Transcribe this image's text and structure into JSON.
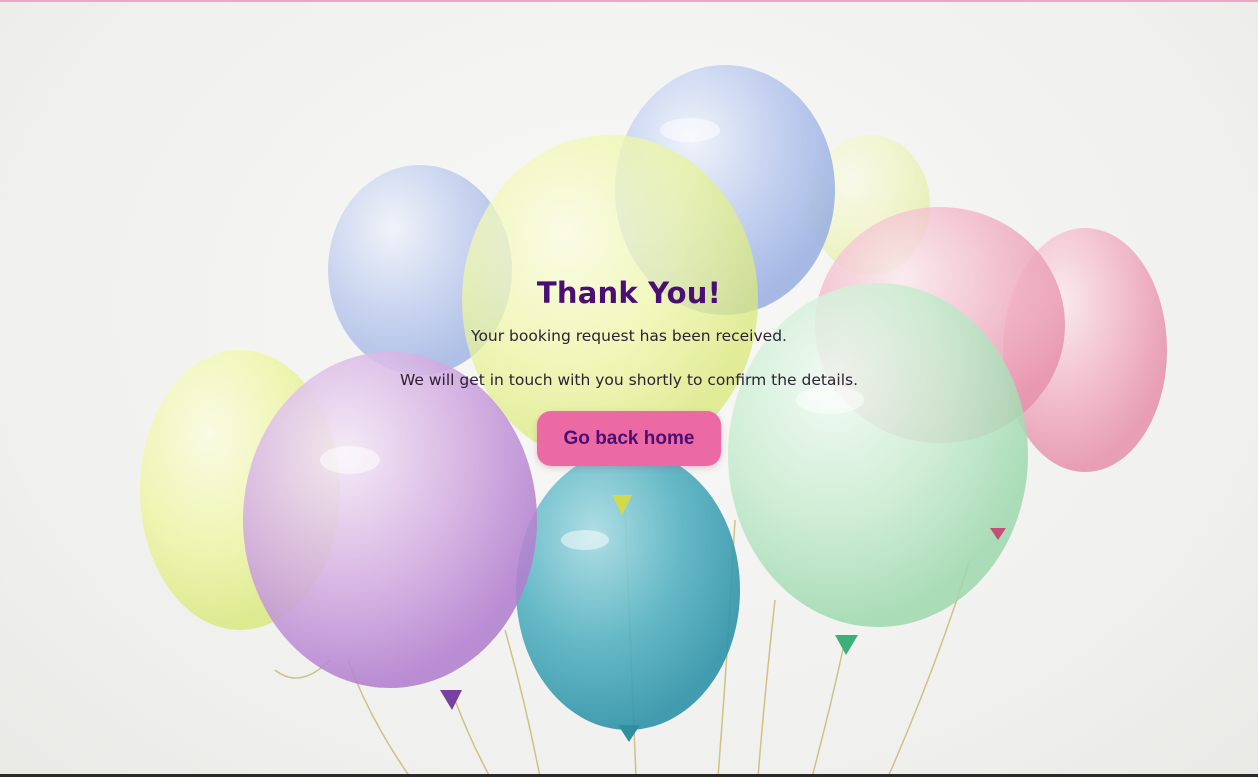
{
  "hero": {
    "title": "Thank You!",
    "message_line_1": "Your booking request has been received.",
    "message_line_2": "We will get in touch with you shortly to confirm the details.",
    "button_label": "Go back home",
    "background_image": "pastel-balloons"
  },
  "colors": {
    "title": "#4b0f73",
    "button_background": "#ec6aa4",
    "button_text": "#4b0f73",
    "body_text": "#2b2233",
    "accent_line": "#e9a9c4"
  }
}
